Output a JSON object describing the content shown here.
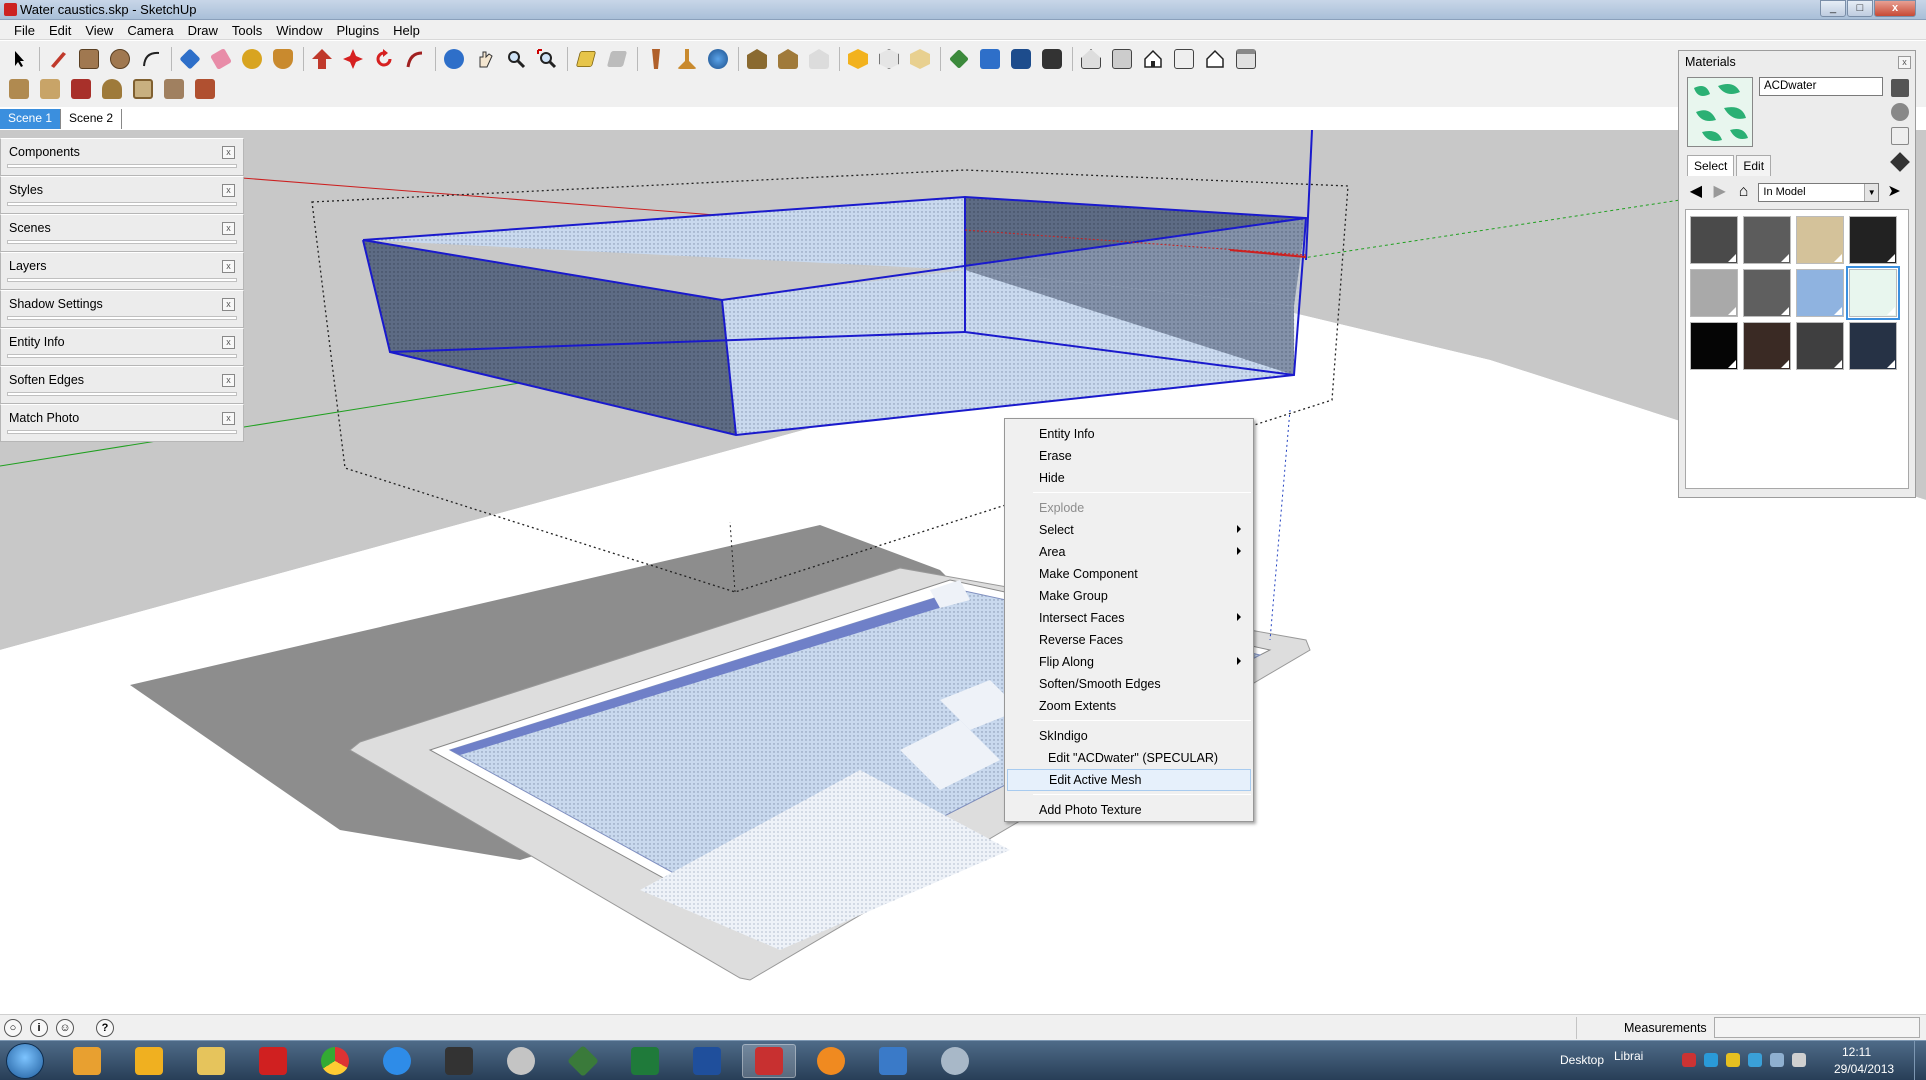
{
  "window": {
    "title": "Water caustics.skp - SketchUp",
    "controls": [
      "_",
      "□",
      "x"
    ]
  },
  "menu": [
    "File",
    "Edit",
    "View",
    "Camera",
    "Draw",
    "Tools",
    "Window",
    "Plugins",
    "Help"
  ],
  "scenes": [
    {
      "label": "Scene 1",
      "active": true
    },
    {
      "label": "Scene 2",
      "active": false
    }
  ],
  "tray": [
    {
      "label": "Components"
    },
    {
      "label": "Styles"
    },
    {
      "label": "Scenes"
    },
    {
      "label": "Layers"
    },
    {
      "label": "Shadow Settings"
    },
    {
      "label": "Entity Info"
    },
    {
      "label": "Soften Edges"
    },
    {
      "label": "Match Photo"
    }
  ],
  "materials": {
    "title": "Materials",
    "close": "x",
    "name": "ACDwater",
    "tabs": [
      "Select",
      "Edit"
    ],
    "collection": "In Model",
    "swatches": [
      {
        "color": "#4a4a4a"
      },
      {
        "color": "#5c5c5c"
      },
      {
        "color": "#d4c29a"
      },
      {
        "color": "#222222"
      },
      {
        "color": "#a9a9a9"
      },
      {
        "color": "#5f5f5f"
      },
      {
        "color": "#8fb3e0"
      },
      {
        "color": "#e8f6ee"
      },
      {
        "color": "#050505"
      },
      {
        "color": "#3a2a24"
      },
      {
        "color": "#3f3f40"
      },
      {
        "color": "#263245"
      }
    ],
    "selected_index": 7
  },
  "context_menu": [
    {
      "label": "Entity Info"
    },
    {
      "label": "Erase"
    },
    {
      "label": "Hide"
    },
    {
      "label": "Explode",
      "disabled": true
    },
    {
      "label": "Select",
      "submenu": true
    },
    {
      "label": "Area",
      "submenu": true
    },
    {
      "label": "Make Component"
    },
    {
      "label": "Make Group"
    },
    {
      "label": "Intersect Faces",
      "submenu": true
    },
    {
      "label": "Reverse Faces"
    },
    {
      "label": "Flip Along",
      "submenu": true
    },
    {
      "label": "Soften/Smooth Edges"
    },
    {
      "label": "Zoom Extents"
    },
    {
      "label": "SkIndigo"
    },
    {
      "label": "Edit \"ACDwater\" (SPECULAR)"
    },
    {
      "label": "Edit Active Mesh",
      "hover": true
    },
    {
      "label": "Add Photo Texture"
    }
  ],
  "statusbar": {
    "measurements_label": "Measurements",
    "help_icon": "?"
  },
  "taskbar": {
    "desktop_label": "Desktop",
    "libraries_label": "Librai",
    "time": "12:11",
    "date": "29/04/2013"
  },
  "colors": {
    "accent": "#3b8fde",
    "edge_selected": "#1a1acc",
    "water_face": "#c9d9ee",
    "water_dark": "#5d6b84"
  }
}
